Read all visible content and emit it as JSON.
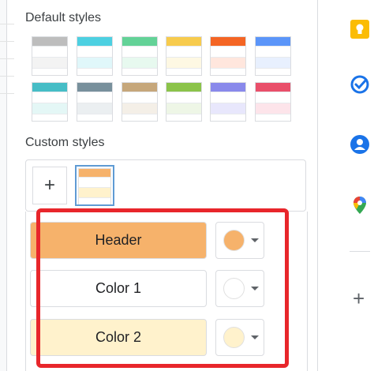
{
  "default_styles": {
    "title": "Default styles",
    "swatches": [
      {
        "header": "#bdbdbd",
        "alt": "#f3f3f3"
      },
      {
        "header": "#4dd0e1",
        "alt": "#e0f7fa"
      },
      {
        "header": "#63d297",
        "alt": "#e7f9ef"
      },
      {
        "header": "#f7cb4d",
        "alt": "#fef8e3"
      },
      {
        "header": "#f46524",
        "alt": "#ffe6dd"
      },
      {
        "header": "#5b95f9",
        "alt": "#e8f0fe"
      },
      {
        "header": "#46bdc6",
        "alt": "#e4f7f6"
      },
      {
        "header": "#78909c",
        "alt": "#ebeff1"
      },
      {
        "header": "#c6a77b",
        "alt": "#f4efe7"
      },
      {
        "header": "#8bc34a",
        "alt": "#eef6e6"
      },
      {
        "header": "#8989eb",
        "alt": "#e8e7fc"
      },
      {
        "header": "#e94f6a",
        "alt": "#fde4ea"
      }
    ]
  },
  "custom_styles": {
    "title": "Custom styles",
    "add_label": "+",
    "selected": {
      "header": "#f6b26b",
      "alt": "#fff2cc"
    }
  },
  "editor": {
    "rows": [
      {
        "label": "Header",
        "fill": "#f6b26b",
        "dot": "#f6b26b"
      },
      {
        "label": "Color 1",
        "fill": "#ffffff",
        "dot": "#ffffff"
      },
      {
        "label": "Color 2",
        "fill": "#fff2cc",
        "dot": "#fff2cc"
      }
    ]
  },
  "colors": {
    "highlight": "#e8262b",
    "accent": "#1a73e8"
  },
  "rail": {
    "icons": [
      "keep-icon",
      "tasks-icon",
      "contacts-icon",
      "maps-icon"
    ],
    "add_label": "+"
  }
}
